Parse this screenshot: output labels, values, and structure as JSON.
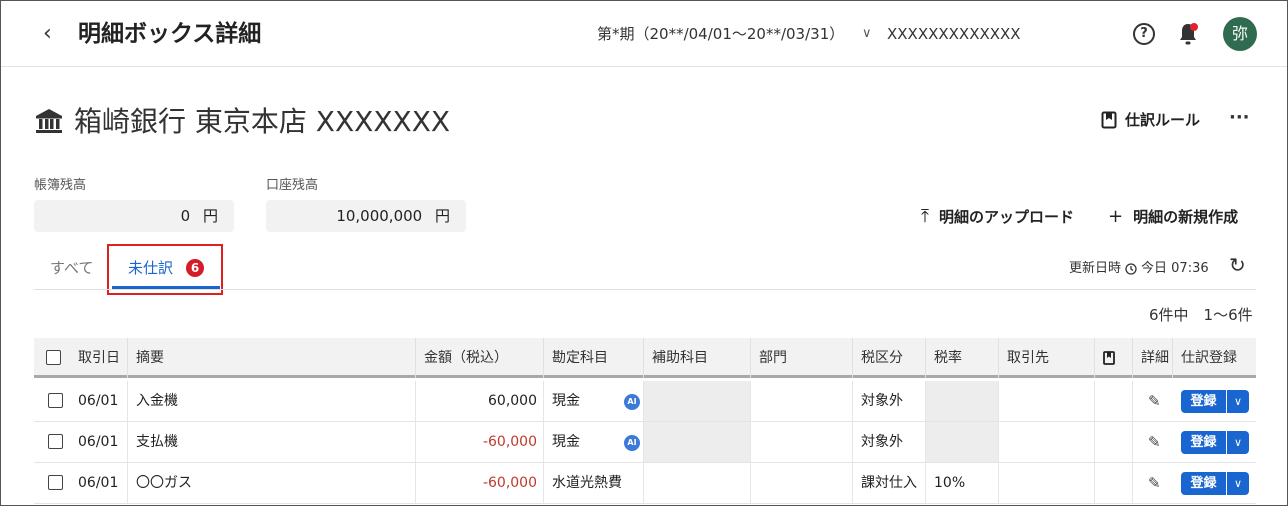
{
  "header": {
    "title": "明細ボックス詳細",
    "period": "第*期（20**/04/01〜20**/03/31）",
    "company": "XXXXXXXXXXXXX",
    "help_label": "?",
    "avatar_text": "弥"
  },
  "account": {
    "name": "箱崎銀行 東京本店 XXXXXXX",
    "rules_label": "仕訳ルール",
    "more_label": "···"
  },
  "balances": {
    "book_label": "帳簿残高",
    "book_value": "0",
    "bank_label": "口座残高",
    "bank_value": "10,000,000",
    "currency": "円"
  },
  "actions": {
    "upload_label": "明細のアップロード",
    "new_label": "明細の新規作成"
  },
  "tabs": {
    "all_label": "すべて",
    "unposted_label": "未仕訳",
    "unposted_count": "6"
  },
  "status": {
    "updated_label": "更新日時",
    "updated_value": "今日 07:36",
    "count_text": "6件中　1〜6件"
  },
  "table": {
    "headers": [
      "取引日",
      "摘要",
      "金額（税込）",
      "勘定科目",
      "補助科目",
      "部門",
      "税区分",
      "税率",
      "取引先",
      "詳細",
      "仕訳登録"
    ],
    "register_label": "登録",
    "ai_label": "AI",
    "rows": [
      {
        "date": "06/01",
        "desc": "入金機",
        "amount": "60,000",
        "negative": false,
        "account": "現金",
        "ai": true,
        "tax_cat": "対象外",
        "tax_rate": ""
      },
      {
        "date": "06/01",
        "desc": "支払機",
        "amount": "-60,000",
        "negative": true,
        "account": "現金",
        "ai": true,
        "tax_cat": "対象外",
        "tax_rate": ""
      },
      {
        "date": "06/01",
        "desc": "〇〇ガス",
        "amount": "-60,000",
        "negative": true,
        "account": "水道光熱費",
        "ai": false,
        "tax_cat": "課対仕入",
        "tax_rate": "10%"
      }
    ]
  },
  "colors": {
    "accent": "#1a66d1",
    "negative": "#c0392b",
    "badge": "#d41d2a",
    "highlight": "#e02020",
    "avatar": "#2f6b4e"
  }
}
